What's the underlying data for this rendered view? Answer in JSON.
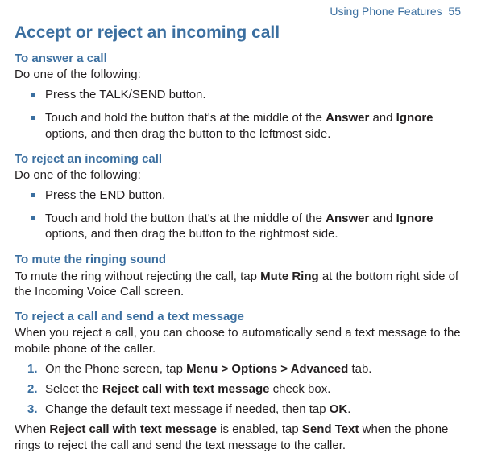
{
  "header": {
    "breadcrumb": "Using Phone Features",
    "page_number": "55"
  },
  "title": "Accept or reject an incoming call",
  "section_answer": {
    "heading": "To answer a call",
    "intro": "Do one of the following:",
    "bullets": [
      {
        "text": "Press the TALK/SEND button."
      },
      {
        "pre": "Touch and hold the button that's at the middle of the ",
        "b1": "Answer",
        "mid": " and ",
        "b2": "Ignore",
        "post": " options, and then drag the button to the leftmost side."
      }
    ]
  },
  "section_reject": {
    "heading": "To reject an incoming call",
    "intro": "Do one of the following:",
    "bullets": [
      {
        "text": "Press the END button."
      },
      {
        "pre": "Touch and hold the button that's at the middle of the ",
        "b1": "Answer",
        "mid": " and ",
        "b2": "Ignore",
        "post": " options, and then drag the button to the rightmost side."
      }
    ]
  },
  "section_mute": {
    "heading": "To mute the ringing sound",
    "pre": "To mute the ring without rejecting the call, tap ",
    "b1": "Mute Ring",
    "post": " at the bottom right side of the Incoming Voice Call screen."
  },
  "section_text": {
    "heading": "To reject a call and send a text message",
    "intro": "When you reject a call, you can choose to automatically send a text message to the mobile phone of the caller.",
    "steps": [
      {
        "num": "1.",
        "pre": "On the Phone screen, tap ",
        "b1": "Menu > Options > Advanced",
        "post": " tab."
      },
      {
        "num": "2.",
        "pre": "Select the ",
        "b1": "Reject call with text message",
        "post": " check box."
      },
      {
        "num": "3.",
        "pre": "Change the default text message if needed, then tap ",
        "b1": "OK",
        "post": "."
      }
    ],
    "outro": {
      "pre": "When ",
      "b1": "Reject call with text message",
      "mid": " is enabled, tap ",
      "b2": "Send Text",
      "post": " when the phone rings to reject the call and send the text message to the caller."
    }
  }
}
